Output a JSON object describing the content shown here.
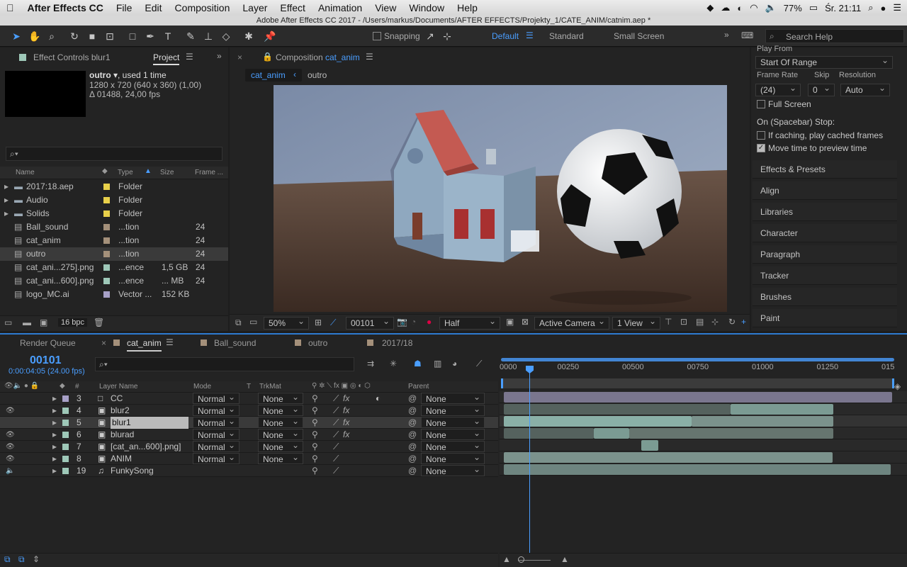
{
  "menubar": {
    "apple": "",
    "app": "After Effects CC",
    "items": [
      "File",
      "Edit",
      "Composition",
      "Layer",
      "Effect",
      "Animation",
      "View",
      "Window",
      "Help"
    ],
    "battery": "77%",
    "clock": "Śr. 21:11"
  },
  "window_title": "Adobe After Effects CC 2017 - /Users/markus/Documents/AFTER EFFECTS/Projekty_1/CATE_ANIM/catnim.aep *",
  "toolbar": {
    "snapping": "Snapping",
    "workspaces": [
      "Default",
      "Standard",
      "Small Screen"
    ],
    "search_placeholder": "Search Help"
  },
  "project_panel": {
    "tab_effect_controls": "Effect Controls blur1",
    "tab_project": "Project",
    "selected_name": "outro",
    "selected_used": ", used 1 time",
    "selected_res": "1280 x 720  (640 x 360) (1,00)",
    "selected_dur": "Δ 01488, 24,00 fps",
    "columns": {
      "name": "Name",
      "type": "Type",
      "size": "Size",
      "frame": "Frame ..."
    },
    "items": [
      {
        "name": "2017:18.aep",
        "type": "Folder",
        "size": "",
        "frame": "",
        "color": "#e8d04a"
      },
      {
        "name": "Audio",
        "type": "Folder",
        "size": "",
        "frame": "",
        "color": "#e8d04a"
      },
      {
        "name": "Solids",
        "type": "Folder",
        "size": "",
        "frame": "",
        "color": "#e8d04a"
      },
      {
        "name": "Ball_sound",
        "type": "...tion",
        "size": "",
        "frame": "24",
        "color": "#a4907a"
      },
      {
        "name": "cat_anim",
        "type": "...tion",
        "size": "",
        "frame": "24",
        "color": "#a4907a"
      },
      {
        "name": "outro",
        "type": "...tion",
        "size": "",
        "frame": "24",
        "color": "#a4907a"
      },
      {
        "name": "cat_ani...275].png",
        "type": "...ence",
        "size": "1,5 GB",
        "frame": "24",
        "color": "#9ec8b8"
      },
      {
        "name": "cat_ani...600].png",
        "type": "...ence",
        "size": "... MB",
        "frame": "24",
        "color": "#9ec8b8"
      },
      {
        "name": "logo_MC.ai",
        "type": "Vector ...",
        "size": "152 KB",
        "frame": "",
        "color": "#a7a0c7"
      }
    ],
    "bpc": "16 bpc"
  },
  "composition": {
    "tab_label": "Composition",
    "tab_comp": "cat_anim",
    "breadcrumb": [
      "cat_anim",
      "outro"
    ],
    "zoom": "50%",
    "timecode": "00101",
    "resolution": "Half",
    "camera": "Active Camera",
    "views": "1 View"
  },
  "preview_panel": {
    "play_from_label": "Play From",
    "play_from": "Start Of Range",
    "frame_rate_label": "Frame Rate",
    "skip_label": "Skip",
    "resolution_label": "Resolution",
    "frame_rate": "(24)",
    "skip": "0",
    "resolution": "Auto",
    "full_screen": "Full Screen",
    "stop_label": "On (Spacebar) Stop:",
    "if_caching": "If caching, play cached frames",
    "move_time": "Move time to preview time"
  },
  "right_panels": [
    "Effects & Presets",
    "Align",
    "Libraries",
    "Character",
    "Paragraph",
    "Tracker",
    "Brushes",
    "Paint"
  ],
  "timeline": {
    "tabs": [
      "Render Queue",
      "cat_anim",
      "Ball_sound",
      "outro",
      "2017/18"
    ],
    "timecode": "00101",
    "timecode_sub": "0:00:04:05 (24.00 fps)",
    "columns": {
      "layer_name": "Layer Name",
      "mode": "Mode",
      "t": "T",
      "trkmat": "TrkMat",
      "parent": "Parent"
    },
    "ruler": [
      "0000",
      "00250",
      "00500",
      "00750",
      "01000",
      "01250",
      "015"
    ],
    "layers": [
      {
        "num": "3",
        "name": "CC",
        "mode": "Normal",
        "trkmat": "None",
        "parent": "None",
        "color": "#a7a0c7"
      },
      {
        "num": "4",
        "name": "blur2",
        "mode": "Normal",
        "trkmat": "None",
        "parent": "None",
        "color": "#9ec8b8"
      },
      {
        "num": "5",
        "name": "blur1",
        "mode": "Normal",
        "trkmat": "None",
        "parent": "None",
        "color": "#9ec8b8"
      },
      {
        "num": "6",
        "name": "blurad",
        "mode": "Normal",
        "trkmat": "None",
        "parent": "None",
        "color": "#9ec8b8"
      },
      {
        "num": "7",
        "name": "[cat_an...600].png]",
        "mode": "Normal",
        "trkmat": "None",
        "parent": "None",
        "color": "#9ec8b8"
      },
      {
        "num": "8",
        "name": "ANIM",
        "mode": "Normal",
        "trkmat": "None",
        "parent": "None",
        "color": "#9ec8b8"
      },
      {
        "num": "19",
        "name": "FunkySong",
        "mode": "",
        "trkmat": "",
        "parent": "None",
        "color": "#9ec8b8"
      }
    ]
  }
}
